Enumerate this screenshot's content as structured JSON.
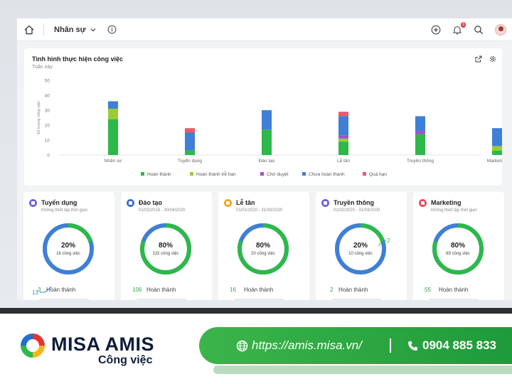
{
  "topbar": {
    "module": "Nhân sự"
  },
  "icons": {
    "home": "home-icon",
    "info": "info-icon",
    "add": "plus-circle-icon",
    "notification": "bell-icon",
    "search": "search-icon"
  },
  "notification_count": "3",
  "chart_card": {
    "title": "Tình hình thực hiện công việc",
    "subtitle": "Tuần này"
  },
  "chart_data": {
    "type": "bar",
    "stacked": true,
    "categories": [
      "Nhân sự",
      "Tuyển dụng",
      "Đào tạo",
      "Lễ tân",
      "Truyền thông",
      "Marketing"
    ],
    "ylabel": "Số lượng công việc",
    "ylim": [
      0,
      50
    ],
    "yticks": [
      0,
      10,
      20,
      30,
      40,
      50
    ],
    "legend_position": "bottom",
    "series": [
      {
        "name": "Hoàn thành",
        "color": "#2db84a",
        "values": [
          24,
          3,
          17,
          9,
          14,
          3
        ]
      },
      {
        "name": "Hoàn thành trễ hạn",
        "color": "#9acd32",
        "values": [
          7,
          0,
          0,
          2,
          0,
          3
        ]
      },
      {
        "name": "Chờ duyệt",
        "color": "#a64fc9",
        "values": [
          0,
          0,
          0,
          2,
          2,
          0
        ]
      },
      {
        "name": "Chưa hoàn thành",
        "color": "#3f7fd6",
        "values": [
          5,
          12,
          13,
          13,
          10,
          12
        ]
      },
      {
        "name": "Quá hạn",
        "color": "#ea5a67",
        "values": [
          0,
          3,
          0,
          3,
          0,
          0
        ]
      }
    ]
  },
  "cards": [
    {
      "title": "Tuyển dụng",
      "subtitle": "Không thiết lập thời gian",
      "percent": "20%",
      "count": "16 công việc",
      "done_num": "3",
      "done_label": "Hoàn thành",
      "callout": "13",
      "icon_color": "#6b63d6",
      "done_fraction": 0.2
    },
    {
      "title": "Đào tạo",
      "subtitle": "01/02/2018 - 30/04/2020",
      "percent": "80%",
      "count": "132 công việc",
      "done_num": "106",
      "done_label": "Hoàn thành",
      "icon_color": "#3f6bd6",
      "done_fraction": 0.8
    },
    {
      "title": "Lễ tân",
      "subtitle": "01/01/2020 - 31/03/2020",
      "percent": "80%",
      "count": "20 công việc",
      "done_num": "16",
      "done_label": "Hoàn thành",
      "icon_color": "#f2a51b",
      "done_fraction": 0.8
    },
    {
      "title": "Truyền thông",
      "subtitle": "01/02/2020 - 31/03/2020",
      "percent": "20%",
      "count": "10 công việc",
      "done_num": "2",
      "done_label": "Hoàn thành",
      "callout": "2",
      "icon_color": "#6b63d6",
      "done_fraction": 0.2
    },
    {
      "title": "Marketing",
      "subtitle": "Không thiết lập thời gian",
      "percent": "80%",
      "count": "69 công việc",
      "done_num": "55",
      "done_label": "Hoàn thành",
      "icon_color": "#e84b5c",
      "done_fraction": 0.8
    }
  ],
  "banner": {
    "brand": "MISA AMIS",
    "product": "Công việc",
    "website": "https://amis.misa.vn/",
    "phone": "0904 885 833"
  }
}
